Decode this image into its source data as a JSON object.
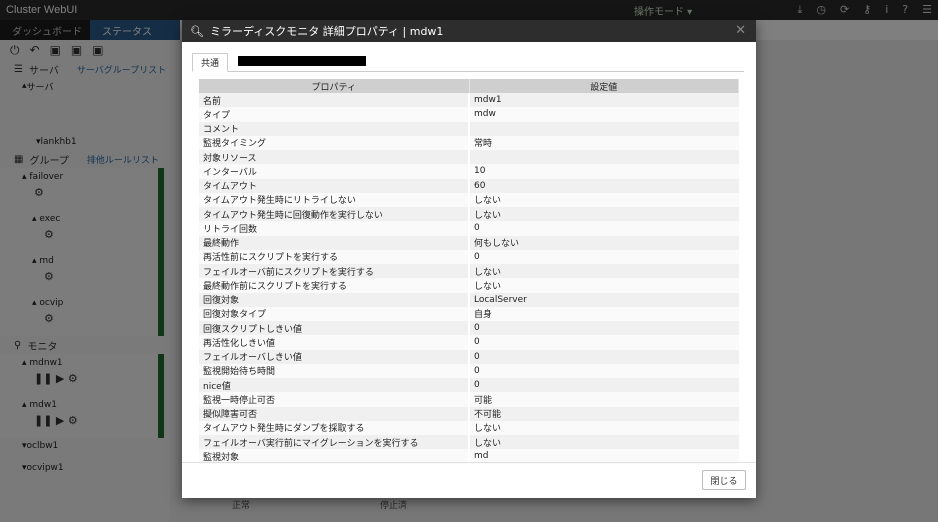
{
  "app": {
    "title": "Cluster WebUI",
    "mode": "操作モード",
    "nav_tabs": [
      "ダッシュボード",
      "ステータス"
    ]
  },
  "left": {
    "server_section": "サーバ",
    "server_group_link": "サーバグループリスト",
    "server_tree": "サーバ",
    "server_item": "lankhb1",
    "group_section": "グループ",
    "group_link": "排他ルールリスト",
    "groups": [
      "failover",
      "exec",
      "md",
      "ocvip"
    ],
    "monitor_section": "モニタ",
    "monitors": [
      "mdnw1",
      "mdw1",
      "oclbw1",
      "ocvipw1"
    ]
  },
  "background": {
    "cell_normal": "正常",
    "cell_stopped": "停止済"
  },
  "modal": {
    "title": "ミラーディスクモニタ 詳細プロパティ | mdw1",
    "tab_common": "共通",
    "header_property": "プロパティ",
    "header_value": "設定値",
    "close_button": "閉じる",
    "rows": [
      {
        "prop": "名前",
        "value": "mdw1"
      },
      {
        "prop": "タイプ",
        "value": "mdw"
      },
      {
        "prop": "コメント",
        "value": ""
      },
      {
        "prop": "監視タイミング",
        "value": "常時"
      },
      {
        "prop": "対象リソース",
        "value": ""
      },
      {
        "prop": "インターバル",
        "value": "10"
      },
      {
        "prop": "タイムアウト",
        "value": "60"
      },
      {
        "prop": "タイムアウト発生時にリトライしない",
        "value": "しない"
      },
      {
        "prop": "タイムアウト発生時に回復動作を実行しない",
        "value": "しない"
      },
      {
        "prop": "リトライ回数",
        "value": "0"
      },
      {
        "prop": "最終動作",
        "value": "何もしない"
      },
      {
        "prop": "再活性前にスクリプトを実行する",
        "value": "0"
      },
      {
        "prop": "フェイルオーバ前にスクリプトを実行する",
        "value": "しない"
      },
      {
        "prop": "最終動作前にスクリプトを実行する",
        "value": "しない"
      },
      {
        "prop": "回復対象",
        "value": "LocalServer"
      },
      {
        "prop": "回復対象タイプ",
        "value": "自身"
      },
      {
        "prop": "回復スクリプトしきい値",
        "value": "0"
      },
      {
        "prop": "再活性化しきい値",
        "value": "0"
      },
      {
        "prop": "フェイルオーバしきい値",
        "value": "0"
      },
      {
        "prop": "監視開始待ち時間",
        "value": "0"
      },
      {
        "prop": "nice値",
        "value": "0"
      },
      {
        "prop": "監視一時停止可否",
        "value": "可能"
      },
      {
        "prop": "擬似障害可否",
        "value": "不可能"
      },
      {
        "prop": "タイムアウト発生時にダンプを採取する",
        "value": "しない"
      },
      {
        "prop": "フェイルオーバ実行前にマイグレーションを実行する",
        "value": "しない"
      },
      {
        "prop": "監視対象",
        "value": "md"
      }
    ]
  }
}
